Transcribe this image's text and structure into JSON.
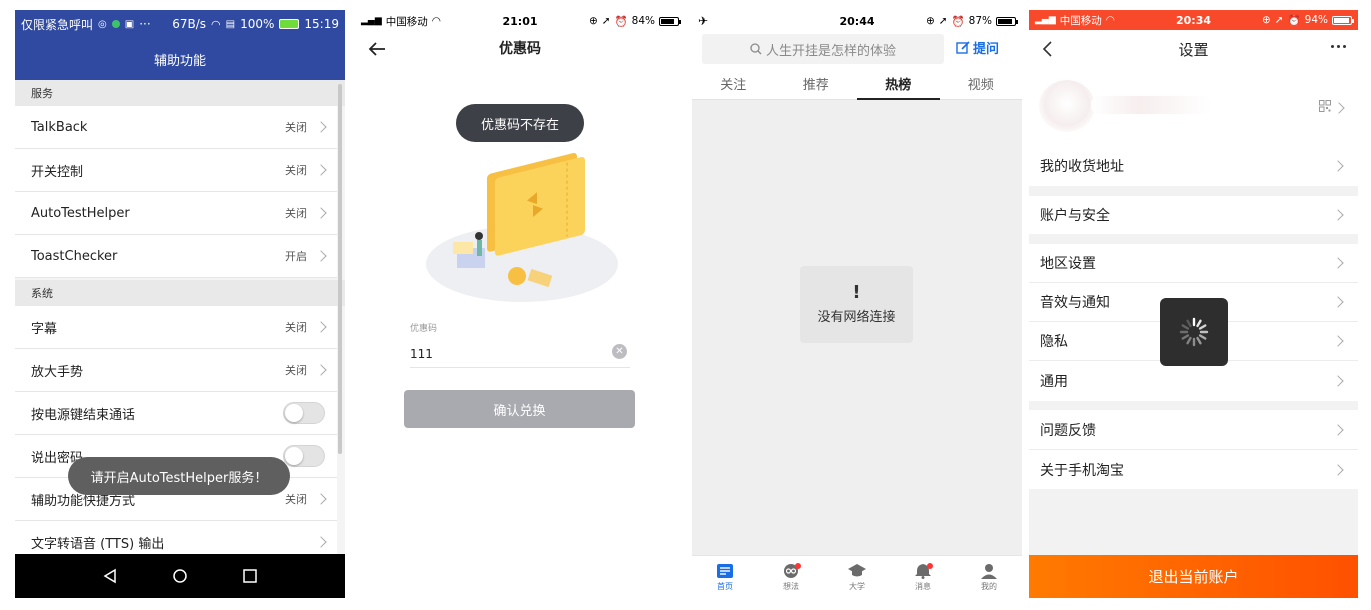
{
  "accessibility": {
    "status_left": "仅限紧急呼叫",
    "status_speed": "67B/s",
    "status_battery": "100%",
    "status_time": "15:19",
    "title": "辅助功能",
    "section_services": "服务",
    "section_system": "系统",
    "rows": [
      {
        "label": "TalkBack",
        "value": "关闭"
      },
      {
        "label": "开关控制",
        "value": "关闭"
      },
      {
        "label": "AutoTestHelper",
        "value": "关闭"
      },
      {
        "label": "ToastChecker",
        "value": "开启"
      },
      {
        "label": "字幕",
        "value": "关闭"
      },
      {
        "label": "放大手势",
        "value": "关闭"
      },
      {
        "label": "按电源键结束通话",
        "value": ""
      },
      {
        "label": "说出密码",
        "value": ""
      },
      {
        "label": "辅助功能快捷方式",
        "value": "关闭"
      },
      {
        "label": "文字转语音 (TTS) 输出",
        "value": ""
      }
    ],
    "toast": "请开启AutoTestHelper服务！",
    "colors": {
      "header": "#2f4aa0"
    }
  },
  "coupon": {
    "carrier": "中国移动",
    "time": "21:01",
    "battery": "84%",
    "title": "优惠码",
    "toast": "优惠码不存在",
    "field_label": "优惠码",
    "field_value": "111",
    "button": "确认兑换"
  },
  "zhihu": {
    "time": "20:44",
    "battery": "87%",
    "search_placeholder": "人生开挂是怎样的体验",
    "ask": "提问",
    "tabs": [
      "关注",
      "推荐",
      "热榜",
      "视频"
    ],
    "active_tab": 2,
    "no_connection": "没有网络连接",
    "bar": [
      "首页",
      "想法",
      "大学",
      "消息",
      "我的"
    ],
    "colors": {
      "accent": "#1a6ee5"
    }
  },
  "taobao": {
    "carrier": "中国移动",
    "time": "20:34",
    "battery": "94%",
    "title": "设置",
    "rows": [
      "我的收货地址",
      "账户与安全",
      "地区设置",
      "音效与通知",
      "隐私",
      "通用",
      "问题反馈",
      "关于手机淘宝"
    ],
    "logout": "退出当前账户",
    "colors": {
      "status": "#f8492b",
      "logout_from": "#ff7a00",
      "logout_to": "#ff5000"
    }
  }
}
